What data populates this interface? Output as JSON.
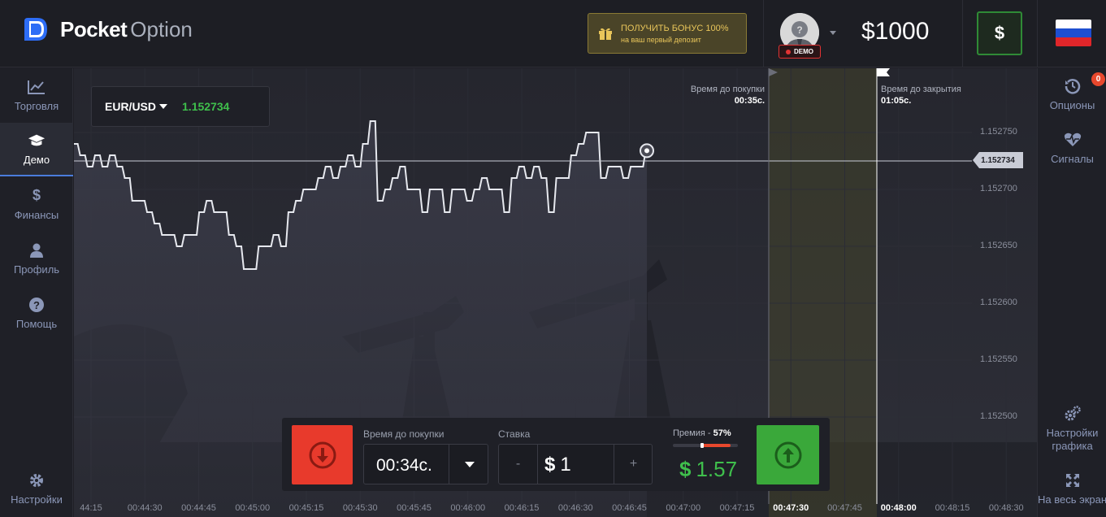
{
  "header": {
    "logo_bold": "Pocket",
    "logo_light": "Option",
    "bonus_line1": "ПОЛУЧИТЬ БОНУС 100%",
    "bonus_line2": "на ваш первый депозит",
    "demo_badge": "DEMO",
    "balance": "$1000",
    "deposit_button": "$",
    "flag_icon": "russia-flag-icon"
  },
  "left_nav": [
    {
      "label": "Торговля",
      "icon": "chart-line-icon"
    },
    {
      "label": "Демо",
      "icon": "graduation-cap-icon",
      "active": true
    },
    {
      "label": "Финансы",
      "icon": "dollar-icon"
    },
    {
      "label": "Профиль",
      "icon": "user-icon"
    },
    {
      "label": "Помощь",
      "icon": "question-icon"
    },
    {
      "label": "Настройки",
      "icon": "gear-icon"
    }
  ],
  "right_nav": [
    {
      "label": "Опционы",
      "icon": "history-icon",
      "badge": "0"
    },
    {
      "label": "Сигналы",
      "icon": "heartbeat-icon"
    },
    {
      "label": "Настройки\nграфика",
      "icon": "gears-icon"
    },
    {
      "label": "На весь экран",
      "icon": "fullscreen-icon"
    }
  ],
  "asset": {
    "pair": "EUR/USD",
    "price": "1.152734"
  },
  "chart_markers": {
    "buy_label": "Время до покупки",
    "buy_time": "00:35с.",
    "close_label": "Время до закрытия",
    "close_time": "01:05с."
  },
  "chart_data": {
    "type": "line",
    "series_name": "EUR/USD",
    "current_price": "1.152734",
    "y_ticks": [
      "1.152750",
      "1.152700",
      "1.152650",
      "1.152600",
      "1.152550",
      "1.152500"
    ],
    "x_ticks": [
      "44:15",
      "00:44:30",
      "00:44:45",
      "00:45:00",
      "00:45:15",
      "00:45:30",
      "00:45:45",
      "00:46:00",
      "00:46:15",
      "00:46:30",
      "00:46:45",
      "00:47:00",
      "00:47:15",
      "00:47:30",
      "00:47:45",
      "00:48:00",
      "00:48:15",
      "00:48:30"
    ],
    "x_ticks_bold": [
      "00:47:30",
      "00:48:00"
    ],
    "ylim": [
      1.15249,
      1.15276
    ],
    "values": [
      1.15274,
      1.15273,
      1.15272,
      1.15273,
      1.15272,
      1.15273,
      1.15272,
      1.15271,
      1.15269,
      1.15269,
      1.15268,
      1.15267,
      1.15266,
      1.15266,
      1.15265,
      1.15266,
      1.15266,
      1.15268,
      1.15269,
      1.15268,
      1.15268,
      1.15266,
      1.15265,
      1.15263,
      1.15263,
      1.15265,
      1.15265,
      1.15266,
      1.15265,
      1.15268,
      1.15269,
      1.1527,
      1.1527,
      1.15271,
      1.15272,
      1.15271,
      1.15272,
      1.15273,
      1.15272,
      1.15274,
      1.15276,
      1.15269,
      1.1527,
      1.15271,
      1.15272,
      1.1527,
      1.1527,
      1.15268,
      1.1527,
      1.1527,
      1.15268,
      1.1527,
      1.1527,
      1.15269,
      1.1527,
      1.15271,
      1.1527,
      1.1527,
      1.15268,
      1.15271,
      1.15272,
      1.15271,
      1.15272,
      1.15271,
      1.15268,
      1.15271,
      1.15271,
      1.15273,
      1.15274,
      1.15275,
      1.15275,
      1.15271,
      1.15272,
      1.15272,
      1.15271,
      1.15272,
      1.15272,
      1.152734
    ]
  },
  "trade_panel": {
    "time_label": "Время до покупки",
    "time_value": "00:34с.",
    "stake_label": "Ставка",
    "stake_minus": "-",
    "stake_currency": "$",
    "stake_value": "1",
    "stake_plus": "+",
    "premium_label": "Премия",
    "premium_value": "57%",
    "premium_level": 0.57,
    "payout_currency": "$",
    "payout_value": "1.57"
  },
  "colors": {
    "down": "#e83a2c",
    "up": "#3aa83a",
    "accent": "#3fbf4c",
    "bonus": "#e8c55a"
  }
}
